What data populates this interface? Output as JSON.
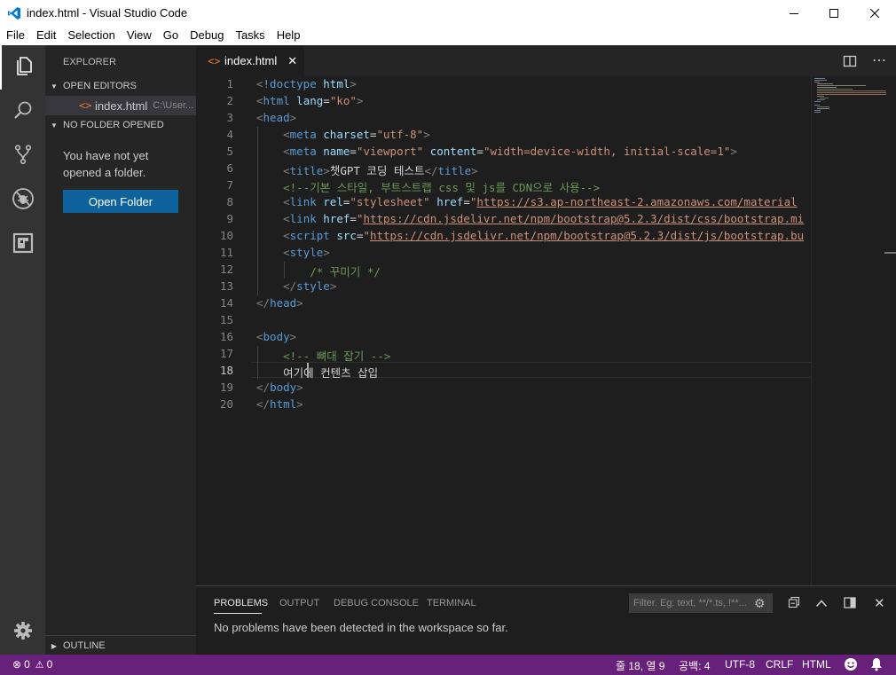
{
  "window": {
    "title": "index.html - Visual Studio Code",
    "controls": [
      "minimize",
      "maximize",
      "close"
    ]
  },
  "menu": [
    "File",
    "Edit",
    "Selection",
    "View",
    "Go",
    "Debug",
    "Tasks",
    "Help"
  ],
  "activity_bar": [
    "files-icon",
    "search-icon",
    "source-control-icon",
    "debug-icon",
    "extensions-icon",
    "settings-gear-icon"
  ],
  "sidebar": {
    "title": "EXPLORER",
    "open_editors": {
      "label": "OPEN EDITORS",
      "file_name": "index.html",
      "file_path": "C:\\User..."
    },
    "no_folder": {
      "label": "NO FOLDER OPENED",
      "message": "You have not yet opened a folder.",
      "button": "Open Folder"
    },
    "outline": "OUTLINE"
  },
  "editor": {
    "tab_label": "index.html",
    "active_line": 18,
    "lines": [
      "<!doctype html>",
      "<html lang=\"ko\">",
      "<head>",
      "    <meta charset=\"utf-8\">",
      "    <meta name=\"viewport\" content=\"width=device-width, initial-scale=1\">",
      "    <title>챗GPT 코딩 테스트</title>",
      "    <!--기본 스타일, 부트스트랩 css 및 js를 CDN으로 사용-->",
      "    <link rel=\"stylesheet\" href=\"https://s3.ap-northeast-2.amazonaws.com/material",
      "    <link href=\"https://cdn.jsdelivr.net/npm/bootstrap@5.2.3/dist/css/bootstrap.mi",
      "    <script src=\"https://cdn.jsdelivr.net/npm/bootstrap@5.2.3/dist/js/bootstrap.bu",
      "    <style>",
      "        /* 꾸미기 */",
      "    </style>",
      "</head>",
      "",
      "<body>",
      "    <!-- 뼈대 잡기 -->",
      "    여기에 컨텐츠 삽입",
      "</body>",
      "</html>"
    ]
  },
  "panel": {
    "tabs": [
      "PROBLEMS",
      "OUTPUT",
      "DEBUG CONSOLE",
      "TERMINAL"
    ],
    "active_tab": "PROBLEMS",
    "filter_placeholder": "Filter. Eg: text, **/*.ts, !**...",
    "message": "No problems have been detected in the workspace so far."
  },
  "status_bar": {
    "errors": "0",
    "warnings": "0",
    "position": "줄 18, 열 9",
    "spaces": "공백: 4",
    "encoding": "UTF-8",
    "eol": "CRLF",
    "language": "HTML"
  },
  "colors": {
    "status_bar": "#68217a",
    "activity_bar": "#333333",
    "sidebar": "#252526",
    "editor": "#1e1e1e",
    "button": "#0e639c"
  }
}
